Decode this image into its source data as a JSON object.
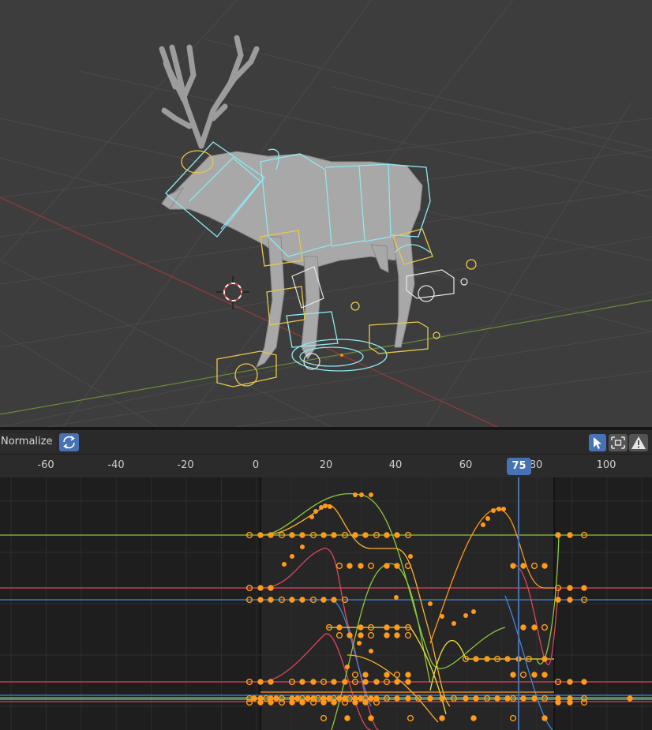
{
  "graph_editor": {
    "normalize_label": "Normalize",
    "current_frame": "75",
    "ruler_ticks": [
      "-60",
      "-40",
      "-20",
      "0",
      "20",
      "40",
      "60",
      "80",
      "100"
    ]
  },
  "icons": {
    "normalize_toggle": "refresh-icon",
    "select": "cursor-arrow-icon",
    "frame": "frame-selected-icon",
    "warning": "warning-icon"
  },
  "colors": {
    "bone_cyan": "#8ee8f0",
    "bone_yellow": "#e8c84a",
    "keyframe": "#ff9a1a",
    "curve_red": "#e0455a",
    "curve_green": "#8cc83a",
    "curve_blue": "#3f86e0",
    "curve_yellow": "#f0e040",
    "playhead": "#4772b3"
  }
}
